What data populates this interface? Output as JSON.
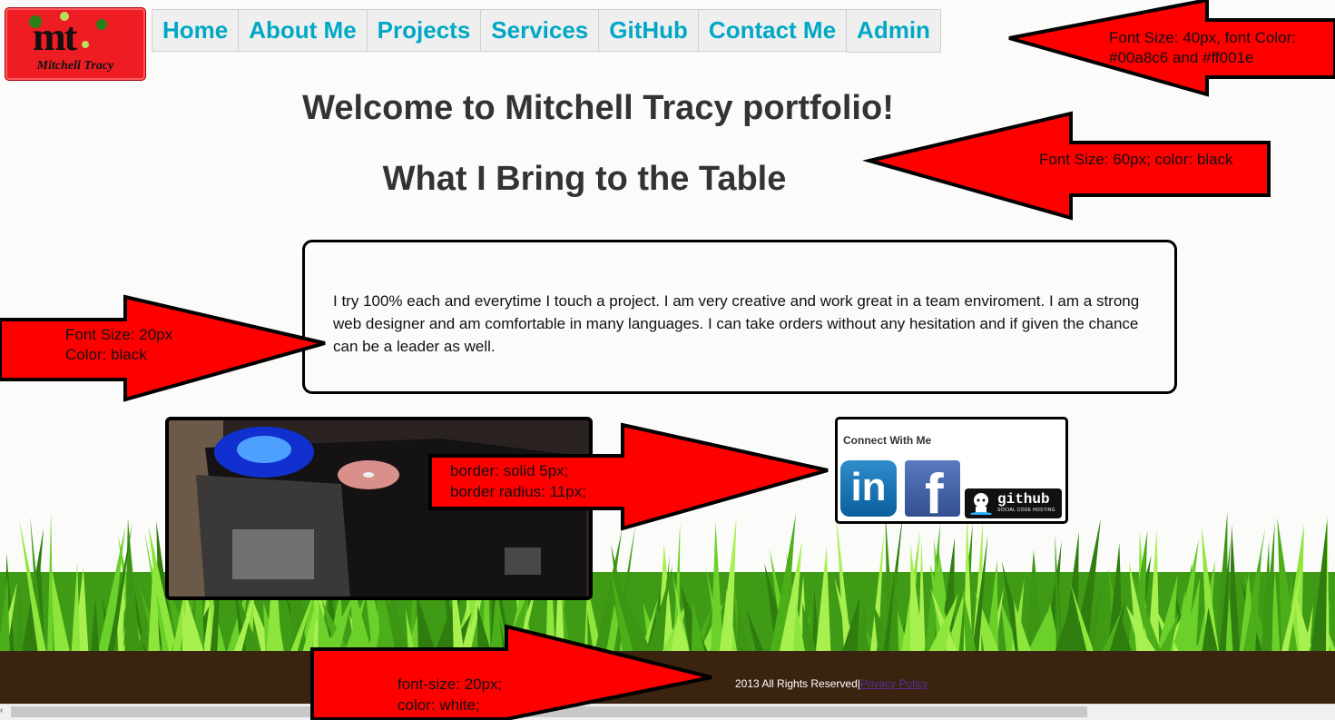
{
  "logo": {
    "initials": "mt",
    "name": "Mitchell Tracy"
  },
  "nav": [
    "Home",
    "About Me",
    "Projects",
    "Services",
    "GitHub",
    "Contact Me",
    "Admin"
  ],
  "headings": {
    "welcome": "Welcome to Mitchell Tracy portfolio!",
    "subtitle": "What I Bring to the Table"
  },
  "intro": "I try 100% each and everytime I touch a project. I am very creative and work great in a team enviroment. I am a strong web designer and am comfortable in many languages. I can take orders without any hesitation and if given the chance can be a leader as well.",
  "connect": {
    "title": "Connect With Me",
    "icons": [
      "linkedin-icon",
      "facebook-icon",
      "github-icon"
    ],
    "linkedin_text": "in",
    "facebook_text": "f",
    "github_text": "github",
    "github_sub": "SOCIAL CODE HOSTING"
  },
  "footer": {
    "copyright": "2013 All Rights Reserved|",
    "privacy": "Privacy Policy"
  },
  "annotations": {
    "nav_line1": "Font Size: 40px, font Color:",
    "nav_line2": "#00a8c6 and #ff001e",
    "heading": "Font Size: 60px; color: black",
    "body_line1": "Font Size: 20px",
    "body_line2": "Color: black",
    "border_line1": "border: solid 5px;",
    "border_line2": "border radius: 11px;",
    "footer_line1": "font-size: 20px;",
    "footer_line2": "color: white;"
  },
  "colors": {
    "nav_text": "#00a8c6",
    "accent_red": "#ff001e",
    "footer_bg": "#3a2410",
    "arrow": "#ff0000"
  }
}
